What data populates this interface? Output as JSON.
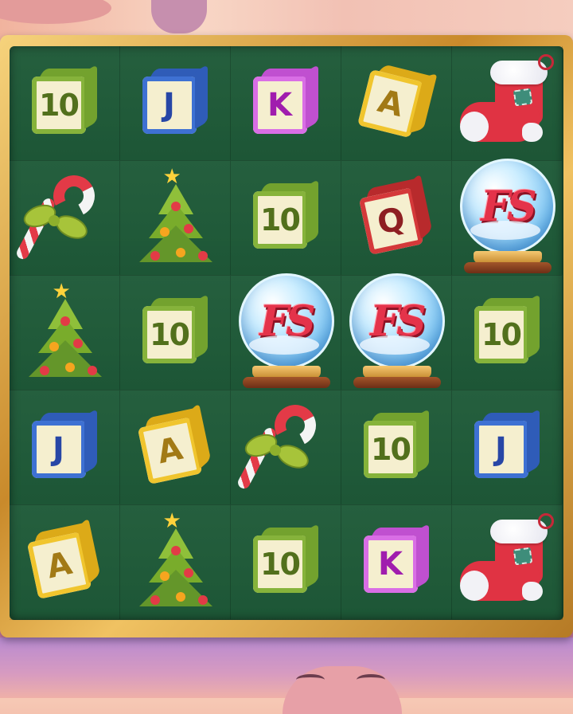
{
  "game": {
    "grid": {
      "columns": 5,
      "rows": 5,
      "cells": [
        [
          {
            "symbol": "10",
            "kind": "cube",
            "color": "green"
          },
          {
            "symbol": "J",
            "kind": "cube",
            "color": "blue"
          },
          {
            "symbol": "K",
            "kind": "cube",
            "color": "pink"
          },
          {
            "symbol": "A",
            "kind": "cube",
            "color": "yellow"
          },
          {
            "symbol": "stocking",
            "kind": "stocking"
          }
        ],
        [
          {
            "symbol": "candy-cane",
            "kind": "cane"
          },
          {
            "symbol": "tree",
            "kind": "tree"
          },
          {
            "symbol": "10",
            "kind": "cube",
            "color": "green"
          },
          {
            "symbol": "Q",
            "kind": "cube",
            "color": "red"
          },
          {
            "symbol": "FS",
            "kind": "globe"
          }
        ],
        [
          {
            "symbol": "tree",
            "kind": "tree"
          },
          {
            "symbol": "10",
            "kind": "cube",
            "color": "green"
          },
          {
            "symbol": "FS",
            "kind": "globe"
          },
          {
            "symbol": "FS",
            "kind": "globe"
          },
          {
            "symbol": "10",
            "kind": "cube",
            "color": "green"
          }
        ],
        [
          {
            "symbol": "J",
            "kind": "cube",
            "color": "blue"
          },
          {
            "symbol": "A",
            "kind": "cube",
            "color": "yellow"
          },
          {
            "symbol": "candy-cane",
            "kind": "cane"
          },
          {
            "symbol": "10",
            "kind": "cube",
            "color": "green"
          },
          {
            "symbol": "J",
            "kind": "cube",
            "color": "blue"
          }
        ],
        [
          {
            "symbol": "A",
            "kind": "cube",
            "color": "yellow"
          },
          {
            "symbol": "tree",
            "kind": "tree"
          },
          {
            "symbol": "10",
            "kind": "cube",
            "color": "green"
          },
          {
            "symbol": "K",
            "kind": "cube",
            "color": "pink"
          },
          {
            "symbol": "stocking",
            "kind": "stocking"
          }
        ]
      ]
    }
  },
  "colors": {
    "board": "#1e5a38",
    "frame": "#d9a441"
  }
}
